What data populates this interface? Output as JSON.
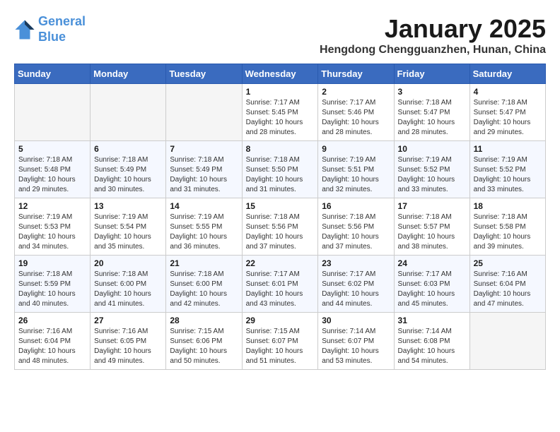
{
  "header": {
    "logo_line1": "General",
    "logo_line2": "Blue",
    "month_title": "January 2025",
    "location": "Hengdong Chengguanzhen, Hunan, China"
  },
  "weekdays": [
    "Sunday",
    "Monday",
    "Tuesday",
    "Wednesday",
    "Thursday",
    "Friday",
    "Saturday"
  ],
  "weeks": [
    [
      {
        "day": "",
        "sunrise": "",
        "sunset": "",
        "daylight": ""
      },
      {
        "day": "",
        "sunrise": "",
        "sunset": "",
        "daylight": ""
      },
      {
        "day": "",
        "sunrise": "",
        "sunset": "",
        "daylight": ""
      },
      {
        "day": "1",
        "sunrise": "7:17 AM",
        "sunset": "5:45 PM",
        "daylight": "10 hours and 28 minutes."
      },
      {
        "day": "2",
        "sunrise": "7:17 AM",
        "sunset": "5:46 PM",
        "daylight": "10 hours and 28 minutes."
      },
      {
        "day": "3",
        "sunrise": "7:18 AM",
        "sunset": "5:47 PM",
        "daylight": "10 hours and 28 minutes."
      },
      {
        "day": "4",
        "sunrise": "7:18 AM",
        "sunset": "5:47 PM",
        "daylight": "10 hours and 29 minutes."
      }
    ],
    [
      {
        "day": "5",
        "sunrise": "7:18 AM",
        "sunset": "5:48 PM",
        "daylight": "10 hours and 29 minutes."
      },
      {
        "day": "6",
        "sunrise": "7:18 AM",
        "sunset": "5:49 PM",
        "daylight": "10 hours and 30 minutes."
      },
      {
        "day": "7",
        "sunrise": "7:18 AM",
        "sunset": "5:49 PM",
        "daylight": "10 hours and 31 minutes."
      },
      {
        "day": "8",
        "sunrise": "7:18 AM",
        "sunset": "5:50 PM",
        "daylight": "10 hours and 31 minutes."
      },
      {
        "day": "9",
        "sunrise": "7:19 AM",
        "sunset": "5:51 PM",
        "daylight": "10 hours and 32 minutes."
      },
      {
        "day": "10",
        "sunrise": "7:19 AM",
        "sunset": "5:52 PM",
        "daylight": "10 hours and 33 minutes."
      },
      {
        "day": "11",
        "sunrise": "7:19 AM",
        "sunset": "5:52 PM",
        "daylight": "10 hours and 33 minutes."
      }
    ],
    [
      {
        "day": "12",
        "sunrise": "7:19 AM",
        "sunset": "5:53 PM",
        "daylight": "10 hours and 34 minutes."
      },
      {
        "day": "13",
        "sunrise": "7:19 AM",
        "sunset": "5:54 PM",
        "daylight": "10 hours and 35 minutes."
      },
      {
        "day": "14",
        "sunrise": "7:19 AM",
        "sunset": "5:55 PM",
        "daylight": "10 hours and 36 minutes."
      },
      {
        "day": "15",
        "sunrise": "7:18 AM",
        "sunset": "5:56 PM",
        "daylight": "10 hours and 37 minutes."
      },
      {
        "day": "16",
        "sunrise": "7:18 AM",
        "sunset": "5:56 PM",
        "daylight": "10 hours and 37 minutes."
      },
      {
        "day": "17",
        "sunrise": "7:18 AM",
        "sunset": "5:57 PM",
        "daylight": "10 hours and 38 minutes."
      },
      {
        "day": "18",
        "sunrise": "7:18 AM",
        "sunset": "5:58 PM",
        "daylight": "10 hours and 39 minutes."
      }
    ],
    [
      {
        "day": "19",
        "sunrise": "7:18 AM",
        "sunset": "5:59 PM",
        "daylight": "10 hours and 40 minutes."
      },
      {
        "day": "20",
        "sunrise": "7:18 AM",
        "sunset": "6:00 PM",
        "daylight": "10 hours and 41 minutes."
      },
      {
        "day": "21",
        "sunrise": "7:18 AM",
        "sunset": "6:00 PM",
        "daylight": "10 hours and 42 minutes."
      },
      {
        "day": "22",
        "sunrise": "7:17 AM",
        "sunset": "6:01 PM",
        "daylight": "10 hours and 43 minutes."
      },
      {
        "day": "23",
        "sunrise": "7:17 AM",
        "sunset": "6:02 PM",
        "daylight": "10 hours and 44 minutes."
      },
      {
        "day": "24",
        "sunrise": "7:17 AM",
        "sunset": "6:03 PM",
        "daylight": "10 hours and 45 minutes."
      },
      {
        "day": "25",
        "sunrise": "7:16 AM",
        "sunset": "6:04 PM",
        "daylight": "10 hours and 47 minutes."
      }
    ],
    [
      {
        "day": "26",
        "sunrise": "7:16 AM",
        "sunset": "6:04 PM",
        "daylight": "10 hours and 48 minutes."
      },
      {
        "day": "27",
        "sunrise": "7:16 AM",
        "sunset": "6:05 PM",
        "daylight": "10 hours and 49 minutes."
      },
      {
        "day": "28",
        "sunrise": "7:15 AM",
        "sunset": "6:06 PM",
        "daylight": "10 hours and 50 minutes."
      },
      {
        "day": "29",
        "sunrise": "7:15 AM",
        "sunset": "6:07 PM",
        "daylight": "10 hours and 51 minutes."
      },
      {
        "day": "30",
        "sunrise": "7:14 AM",
        "sunset": "6:07 PM",
        "daylight": "10 hours and 53 minutes."
      },
      {
        "day": "31",
        "sunrise": "7:14 AM",
        "sunset": "6:08 PM",
        "daylight": "10 hours and 54 minutes."
      },
      {
        "day": "",
        "sunrise": "",
        "sunset": "",
        "daylight": ""
      }
    ]
  ],
  "labels": {
    "sunrise_prefix": "Sunrise: ",
    "sunset_prefix": "Sunset: ",
    "daylight_prefix": "Daylight: "
  }
}
